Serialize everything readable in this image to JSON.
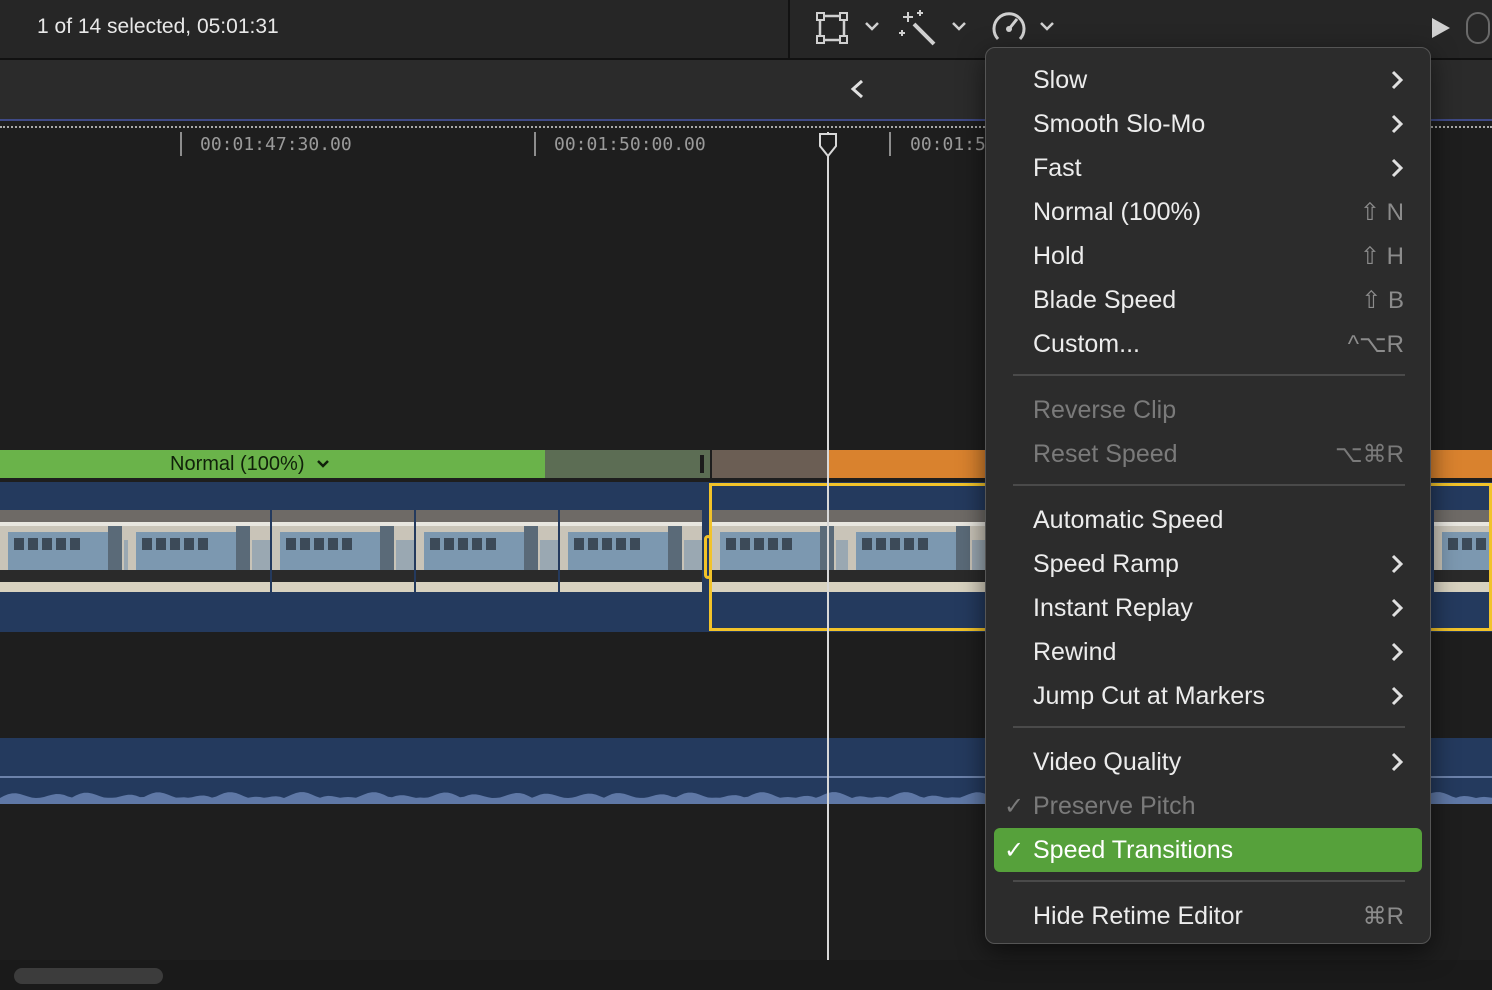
{
  "toolbar": {
    "status": "1 of 14 selected, 05:01:31",
    "icons": [
      "transform-icon",
      "magic-wand-icon",
      "retime-speedometer-icon",
      "play-icon"
    ]
  },
  "timeline": {
    "timecodes": [
      "00:01:47:30.00",
      "00:01:50:00.00",
      "00:01:5"
    ],
    "retime_label": "Normal (100%)",
    "colors": {
      "normal": "#6ab34a",
      "fast": "#d9822e",
      "selection": "#f2c32a"
    }
  },
  "menu": {
    "items": [
      {
        "label": "Slow",
        "submenu": true
      },
      {
        "label": "Smooth Slo-Mo",
        "submenu": true
      },
      {
        "label": "Fast",
        "submenu": true
      },
      {
        "label": "Normal (100%)",
        "shortcut": "⇧ N"
      },
      {
        "label": "Hold",
        "shortcut": "⇧ H"
      },
      {
        "label": "Blade Speed",
        "shortcut": "⇧ B"
      },
      {
        "label": "Custom...",
        "shortcut": "^⌥R"
      },
      {
        "label": "Reverse Clip",
        "disabled": true
      },
      {
        "label": "Reset Speed",
        "shortcut": "⌥⌘R",
        "disabled": true
      },
      {
        "label": "Automatic Speed"
      },
      {
        "label": "Speed Ramp",
        "submenu": true
      },
      {
        "label": "Instant Replay",
        "submenu": true
      },
      {
        "label": "Rewind",
        "submenu": true
      },
      {
        "label": "Jump Cut at Markers",
        "submenu": true
      },
      {
        "label": "Video Quality",
        "submenu": true
      },
      {
        "label": "Preserve Pitch",
        "checked": true,
        "disabled": true
      },
      {
        "label": "Speed Transitions",
        "checked": true,
        "highlighted": true
      },
      {
        "label": "Hide Retime Editor",
        "shortcut": "⌘R"
      }
    ],
    "check_glyph": "✓"
  }
}
